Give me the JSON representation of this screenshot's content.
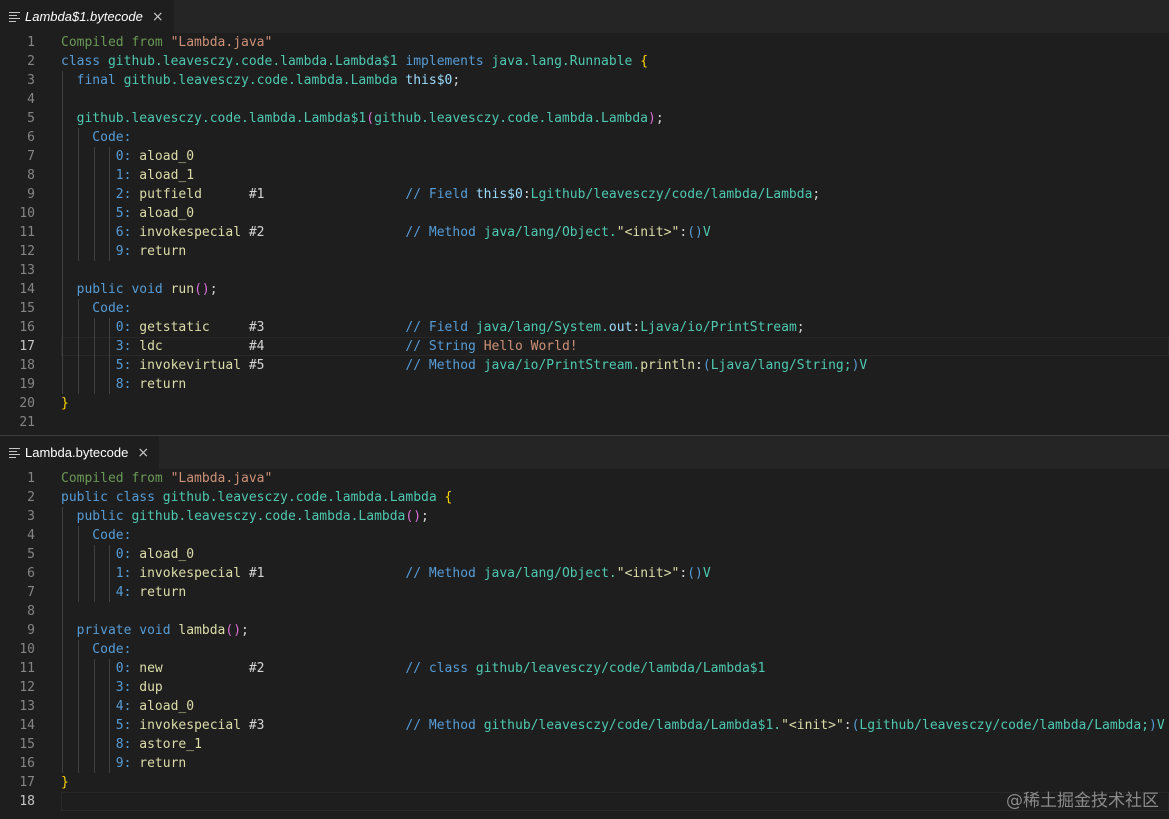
{
  "colors": {
    "plain": "#d4d4d4",
    "keyword": "#569cd6",
    "type": "#4ec9b0",
    "comment": "#6a9955",
    "string": "#ce9178",
    "func": "#dcdcaa",
    "variable": "#9cdcfe",
    "number": "#b5cea8",
    "brace": "#ffd700",
    "paren": "#da70d6"
  },
  "panes": [
    {
      "tab": {
        "label": "Lambda$1.bytecode",
        "italic": true,
        "icon": "file-lines-icon",
        "close": "×"
      },
      "current_line": 17,
      "lines": [
        [
          [
            "Compiled from ",
            "comment"
          ],
          [
            "\"Lambda.java\"",
            "string"
          ]
        ],
        [
          [
            "class ",
            "keyword"
          ],
          [
            "github.leavesczy.code.lambda.Lambda$1",
            "type"
          ],
          [
            " implements ",
            "keyword"
          ],
          [
            "java.lang.Runnable",
            "type"
          ],
          [
            " ",
            "plain"
          ],
          [
            "{",
            "brace"
          ]
        ],
        [
          [
            "  final ",
            "keyword"
          ],
          [
            "github.leavesczy.code.lambda.Lambda",
            "type"
          ],
          [
            " this$0",
            "variable"
          ],
          [
            ";",
            "plain"
          ]
        ],
        [],
        [
          [
            "  github.leavesczy.code.lambda.Lambda$1",
            "type"
          ],
          [
            "(",
            "paren"
          ],
          [
            "github.leavesczy.code.lambda.Lambda",
            "type"
          ],
          [
            ")",
            "paren"
          ],
          [
            ";",
            "plain"
          ]
        ],
        [
          [
            "    Code:",
            "keyword"
          ]
        ],
        [
          [
            "       0: ",
            "keyword"
          ],
          [
            "aload_0",
            "func"
          ]
        ],
        [
          [
            "       1: ",
            "keyword"
          ],
          [
            "aload_1",
            "func"
          ]
        ],
        [
          [
            "       2: ",
            "keyword"
          ],
          [
            "putfield      ",
            "func"
          ],
          [
            "#1                  ",
            "plain"
          ],
          [
            "// Field ",
            "keyword"
          ],
          [
            "this$0",
            "variable"
          ],
          [
            ":",
            "plain"
          ],
          [
            "Lgithub/leavesczy/code/lambda/Lambda",
            "type"
          ],
          [
            ";",
            "plain"
          ]
        ],
        [
          [
            "       5: ",
            "keyword"
          ],
          [
            "aload_0",
            "func"
          ]
        ],
        [
          [
            "       6: ",
            "keyword"
          ],
          [
            "invokespecial ",
            "func"
          ],
          [
            "#2                  ",
            "plain"
          ],
          [
            "// Method ",
            "keyword"
          ],
          [
            "java/lang/Object.",
            "type"
          ],
          [
            "\"<init>\"",
            "func"
          ],
          [
            ":",
            "plain"
          ],
          [
            "()",
            "keyword"
          ],
          [
            "V",
            "type"
          ]
        ],
        [
          [
            "       9: ",
            "keyword"
          ],
          [
            "return",
            "func"
          ]
        ],
        [],
        [
          [
            "  public void ",
            "keyword"
          ],
          [
            "run",
            "func"
          ],
          [
            "()",
            "paren"
          ],
          [
            ";",
            "plain"
          ]
        ],
        [
          [
            "    Code:",
            "keyword"
          ]
        ],
        [
          [
            "       0: ",
            "keyword"
          ],
          [
            "getstatic     ",
            "func"
          ],
          [
            "#3                  ",
            "plain"
          ],
          [
            "// Field ",
            "keyword"
          ],
          [
            "java/lang/System.",
            "type"
          ],
          [
            "out",
            "variable"
          ],
          [
            ":",
            "plain"
          ],
          [
            "Ljava/io/PrintStream",
            "type"
          ],
          [
            ";",
            "plain"
          ]
        ],
        [
          [
            "       3: ",
            "keyword"
          ],
          [
            "ldc           ",
            "func"
          ],
          [
            "#4                  ",
            "plain"
          ],
          [
            "// String ",
            "keyword"
          ],
          [
            "Hello World!",
            "string"
          ]
        ],
        [
          [
            "       5: ",
            "keyword"
          ],
          [
            "invokevirtual ",
            "func"
          ],
          [
            "#5                  ",
            "plain"
          ],
          [
            "// Method ",
            "keyword"
          ],
          [
            "java/io/PrintStream.",
            "type"
          ],
          [
            "println",
            "func"
          ],
          [
            ":",
            "plain"
          ],
          [
            "(",
            "keyword"
          ],
          [
            "Ljava/lang/String;",
            "type"
          ],
          [
            ")",
            "keyword"
          ],
          [
            "V",
            "type"
          ]
        ],
        [
          [
            "       8: ",
            "keyword"
          ],
          [
            "return",
            "func"
          ]
        ],
        [
          [
            "}",
            "brace"
          ]
        ],
        []
      ]
    },
    {
      "tab": {
        "label": "Lambda.bytecode",
        "italic": false,
        "icon": "file-lines-icon",
        "close": "×"
      },
      "current_line": 18,
      "lines": [
        [
          [
            "Compiled from ",
            "comment"
          ],
          [
            "\"Lambda.java\"",
            "string"
          ]
        ],
        [
          [
            "public class ",
            "keyword"
          ],
          [
            "github.leavesczy.code.lambda.Lambda",
            "type"
          ],
          [
            " ",
            "plain"
          ],
          [
            "{",
            "brace"
          ]
        ],
        [
          [
            "  public ",
            "keyword"
          ],
          [
            "github.leavesczy.code.lambda.Lambda",
            "type"
          ],
          [
            "()",
            "paren"
          ],
          [
            ";",
            "plain"
          ]
        ],
        [
          [
            "    Code:",
            "keyword"
          ]
        ],
        [
          [
            "       0: ",
            "keyword"
          ],
          [
            "aload_0",
            "func"
          ]
        ],
        [
          [
            "       1: ",
            "keyword"
          ],
          [
            "invokespecial ",
            "func"
          ],
          [
            "#1                  ",
            "plain"
          ],
          [
            "// Method ",
            "keyword"
          ],
          [
            "java/lang/Object.",
            "type"
          ],
          [
            "\"<init>\"",
            "func"
          ],
          [
            ":",
            "plain"
          ],
          [
            "()",
            "keyword"
          ],
          [
            "V",
            "type"
          ]
        ],
        [
          [
            "       4: ",
            "keyword"
          ],
          [
            "return",
            "func"
          ]
        ],
        [],
        [
          [
            "  private void ",
            "keyword"
          ],
          [
            "lambda",
            "func"
          ],
          [
            "()",
            "paren"
          ],
          [
            ";",
            "plain"
          ]
        ],
        [
          [
            "    Code:",
            "keyword"
          ]
        ],
        [
          [
            "       0: ",
            "keyword"
          ],
          [
            "new           ",
            "func"
          ],
          [
            "#2                  ",
            "plain"
          ],
          [
            "// class ",
            "keyword"
          ],
          [
            "github/leavesczy/code/lambda/Lambda$1",
            "type"
          ]
        ],
        [
          [
            "       3: ",
            "keyword"
          ],
          [
            "dup",
            "func"
          ]
        ],
        [
          [
            "       4: ",
            "keyword"
          ],
          [
            "aload_0",
            "func"
          ]
        ],
        [
          [
            "       5: ",
            "keyword"
          ],
          [
            "invokespecial ",
            "func"
          ],
          [
            "#3                  ",
            "plain"
          ],
          [
            "// Method ",
            "keyword"
          ],
          [
            "github/leavesczy/code/lambda/Lambda$1.",
            "type"
          ],
          [
            "\"<init>\"",
            "func"
          ],
          [
            ":",
            "plain"
          ],
          [
            "(",
            "keyword"
          ],
          [
            "Lgithub/leavesczy/code/lambda/Lambda;",
            "type"
          ],
          [
            ")",
            "keyword"
          ],
          [
            "V",
            "type"
          ]
        ],
        [
          [
            "       8: ",
            "keyword"
          ],
          [
            "astore_1",
            "func"
          ]
        ],
        [
          [
            "       9: ",
            "keyword"
          ],
          [
            "return",
            "func"
          ]
        ],
        [
          [
            "}",
            "brace"
          ]
        ],
        []
      ]
    }
  ],
  "watermark": "@稀土掘金技术社区"
}
